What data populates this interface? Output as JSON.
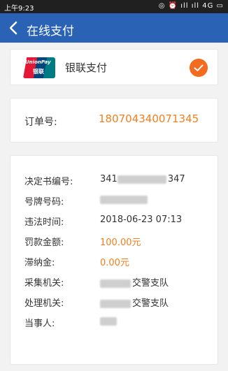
{
  "status_bar": {
    "time": "上午9:23",
    "icons": "◎ ⏰ ıll ıll 4G ▭"
  },
  "app_bar": {
    "title": "在线支付",
    "back_icon": "chevron-left-icon"
  },
  "payment_method": {
    "logo_text_en": "UnionPay",
    "logo_text_cn": "银联",
    "label": "银联支付",
    "selected": true
  },
  "order": {
    "label": "订单号:",
    "value": "180704340071345"
  },
  "details": {
    "decision_no": {
      "label": "决定书编号:",
      "prefix": "341",
      "suffix": "347"
    },
    "plate_no": {
      "label": "号牌号码:"
    },
    "violation_time": {
      "label": "违法时间:",
      "value": "2018-06-23 07:13"
    },
    "fine_amount": {
      "label": "罚款金额:",
      "value": "100.00元"
    },
    "late_fee": {
      "label": "滞纳金:",
      "value": "0.00元"
    },
    "collecting_org": {
      "label": "采集机关:",
      "suffix": "交警支队"
    },
    "processing_org": {
      "label": "处理机关:",
      "suffix": "交警支队"
    },
    "party": {
      "label": "当事人:"
    }
  },
  "colors": {
    "app_bar": "#2a63b6",
    "accent_orange": "#f07f1f",
    "check_orange": "#f26b21"
  }
}
